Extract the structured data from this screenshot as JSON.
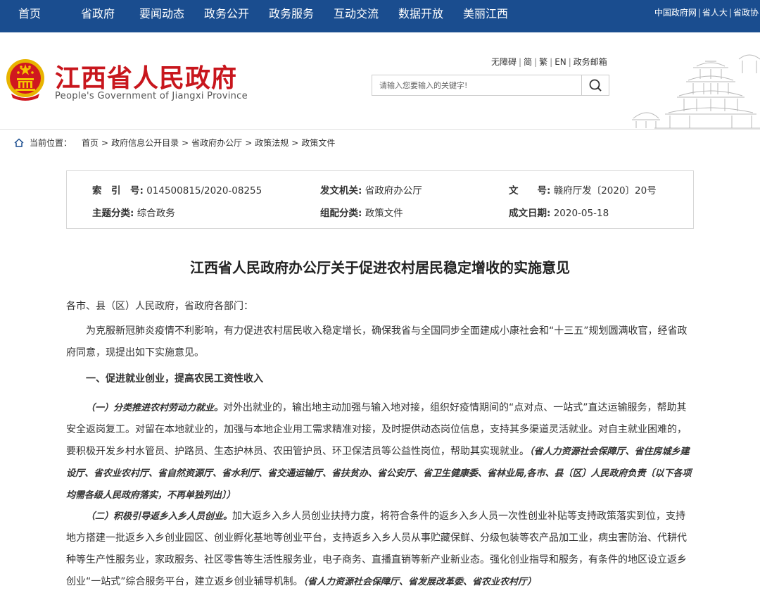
{
  "topnav": {
    "items": [
      "首页",
      "省政府",
      "要闻动态",
      "政务公开",
      "政务服务",
      "互动交流",
      "数据开放",
      "美丽江西"
    ],
    "right_links": [
      "中国政府网",
      "省人大",
      "省政协"
    ],
    "bg_color": "#1a4d8f"
  },
  "header": {
    "title": "江西省人民政府",
    "subtitle": "People's Government of Jiangxi Province",
    "util_links": [
      "无障碍",
      "简",
      "繁",
      "EN",
      "政务邮箱"
    ],
    "search_placeholder": "请输入您要输入的关键字!",
    "title_color": "#c8161d"
  },
  "breadcrumb": {
    "label": "当前位置：",
    "items": [
      "首页",
      "政府信息公开目录",
      "省政府办公厅",
      "政策法规",
      "政策文件"
    ]
  },
  "meta": {
    "index_label": "索　引　号:",
    "index_value": "014500815/2020-08255",
    "issuer_label": "发文机关:",
    "issuer_value": "省政府办公厅",
    "docno_label": "文　　号:",
    "docno_value": "赣府厅发〔2020〕20号",
    "topic_label": "主题分类:",
    "topic_value": "综合政务",
    "group_label": "组配分类:",
    "group_value": "政策文件",
    "date_label": "成文日期:",
    "date_value": "2020-05-18"
  },
  "article": {
    "title": "江西省人民政府办公厅关于促进农村居民稳定增收的实施意见",
    "salutation": "各市、县（区）人民政府，省政府各部门：",
    "intro": "为克服新冠肺炎疫情不利影响，有力促进农村居民收入稳定增长，确保我省与全国同步全面建成小康社会和“十三五”规划圆满收官，经省政府同意，现提出如下实施意见。",
    "section1": "一、促进就业创业，提高农民工资性收入",
    "item1_head": "（一）分类推进农村劳动力就业。",
    "item1_body": "对外出就业的，输出地主动加强与输入地对接，组织好疫情期间的“点对点、一站式”直达运输服务，帮助其安全返岗复工。对留在本地就业的，加强与本地企业用工需求精准对接，及时提供动态岗位信息，支持其多渠道灵活就业。对自主就业困难的，要积极开发乡村水管员、护路员、生态护林员、农田管护员、环卫保洁员等公益性岗位，帮助其实现就业。",
    "item1_resp": "（省人力资源社会保障厅、省住房城乡建设厅、省农业农村厅、省自然资源厅、省水利厅、省交通运输厅、省扶贫办、省公安厅、省卫生健康委、省林业局,各市、县〔区〕人民政府负责〔以下各项均需各级人民政府落实，不再单独列出〕）",
    "item2_head": "（二）积极引导返乡入乡人员创业。",
    "item2_body": "加大返乡入乡人员创业扶持力度，将符合条件的返乡入乡人员一次性创业补贴等支持政策落实到位，支持地方搭建一批返乡入乡创业园区、创业孵化基地等创业平台，支持返乡入乡人员从事贮藏保鲜、分级包装等农产品加工业，病虫害防治、代耕代种等生产性服务业，家政服务、社区零售等生活性服务业，电子商务、直播直销等新产业新业态。强化创业指导和服务，有条件的地区设立返乡创业“一站式”综合服务平台，建立返乡创业辅导机制。",
    "item2_resp": "（省人力资源社会保障厅、省发展改革委、省农业农村厅）"
  }
}
